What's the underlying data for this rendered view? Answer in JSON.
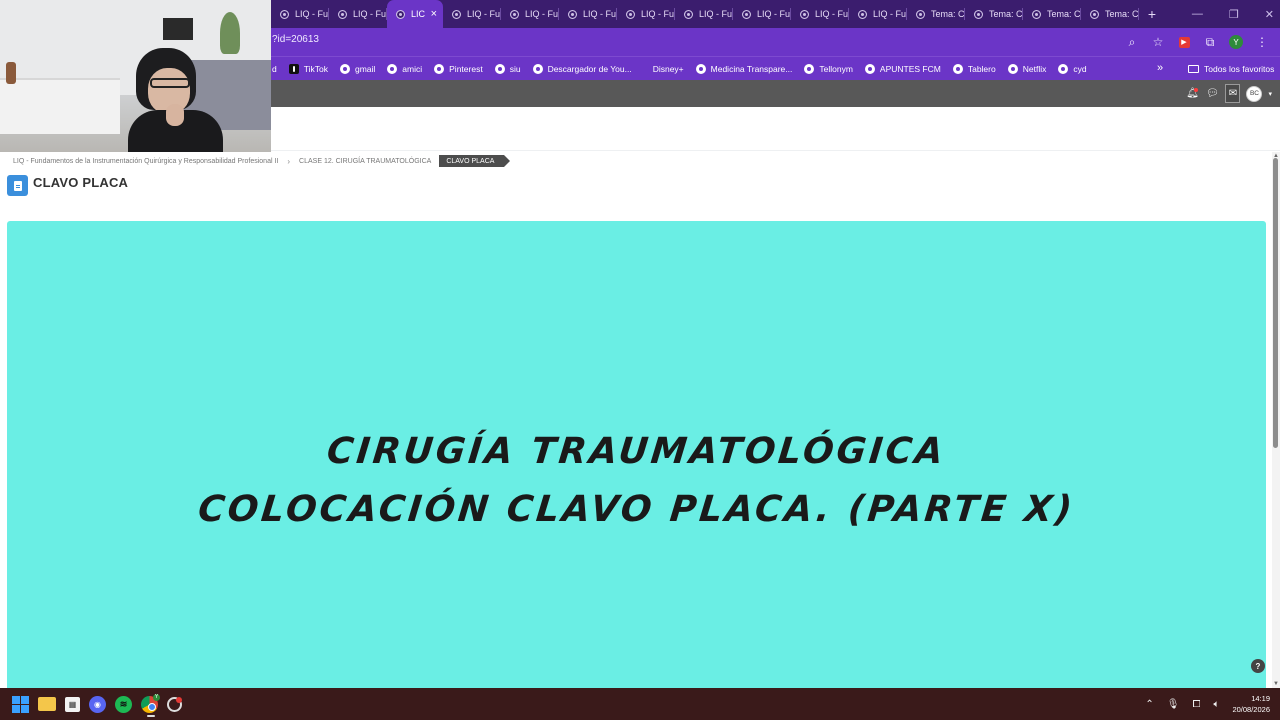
{
  "browser": {
    "tabs": [
      {
        "label": "LIQ - Fu",
        "active": false
      },
      {
        "label": "LIQ - Fu",
        "active": false
      },
      {
        "label": "LIC",
        "active": true
      },
      {
        "label": "LIQ - Fu",
        "active": false
      },
      {
        "label": "LIQ - Fu",
        "active": false
      },
      {
        "label": "LIQ - Fu",
        "active": false
      },
      {
        "label": "LIQ - Fu",
        "active": false
      },
      {
        "label": "LIQ - Fu",
        "active": false
      },
      {
        "label": "LIQ - Fu",
        "active": false
      },
      {
        "label": "LIQ - Fu",
        "active": false
      },
      {
        "label": "LIQ - Fu",
        "active": false
      },
      {
        "label": "Tema: C",
        "active": false
      },
      {
        "label": "Tema: C",
        "active": false
      },
      {
        "label": "Tema: C",
        "active": false
      },
      {
        "label": "Tema: C",
        "active": false
      }
    ],
    "new_tab_label": "+",
    "close_tab_label": "×",
    "url": "?id=20613",
    "profile_initial": "Y",
    "bookmarks": [
      {
        "label": "d",
        "icon": "none"
      },
      {
        "label": "TikTok",
        "icon": "tiktok"
      },
      {
        "label": "gmail",
        "icon": "globe"
      },
      {
        "label": "amici",
        "icon": "globe"
      },
      {
        "label": "Pinterest",
        "icon": "globe"
      },
      {
        "label": "siu",
        "icon": "globe"
      },
      {
        "label": "Descargador de You...",
        "icon": "globe"
      },
      {
        "label": "Disney+",
        "icon": "disney"
      },
      {
        "label": "Medicina Transpare...",
        "icon": "globe"
      },
      {
        "label": "Tellonym",
        "icon": "globe"
      },
      {
        "label": "APUNTES FCM",
        "icon": "globe"
      },
      {
        "label": "Tablero",
        "icon": "globe"
      },
      {
        "label": "Netflix",
        "icon": "globe"
      },
      {
        "label": "cyd",
        "icon": "globe"
      }
    ],
    "bookmarks_more": "»",
    "all_favorites_label": "Todos los favoritos"
  },
  "site": {
    "user_initials": "BC",
    "breadcrumb": [
      "LIQ - Fundamentos de la Instrumentación Quirúrgica y Responsabilidad Profesional II",
      "CLASE 12. CIRUGÍA TRAUMATOLÓGICA"
    ],
    "breadcrumb_separator": "›",
    "breadcrumb_current": "CLAVO PLACA",
    "page_title": "CLAVO PLACA",
    "slide": {
      "line1": "CIRUGÍA TRAUMATOLÓGICA",
      "line2": "COLOCACIÓN CLAVO PLACA. (PARTE X)",
      "background": "#6aeee4"
    },
    "help_label": "?"
  },
  "taskbar": {
    "time": "14:19",
    "date": "20/08/2026"
  },
  "colors": {
    "tabstrip": "#3b1d6e",
    "accent": "#6b35c7",
    "site_header": "#585858",
    "taskbar": "#3a1a1a"
  }
}
